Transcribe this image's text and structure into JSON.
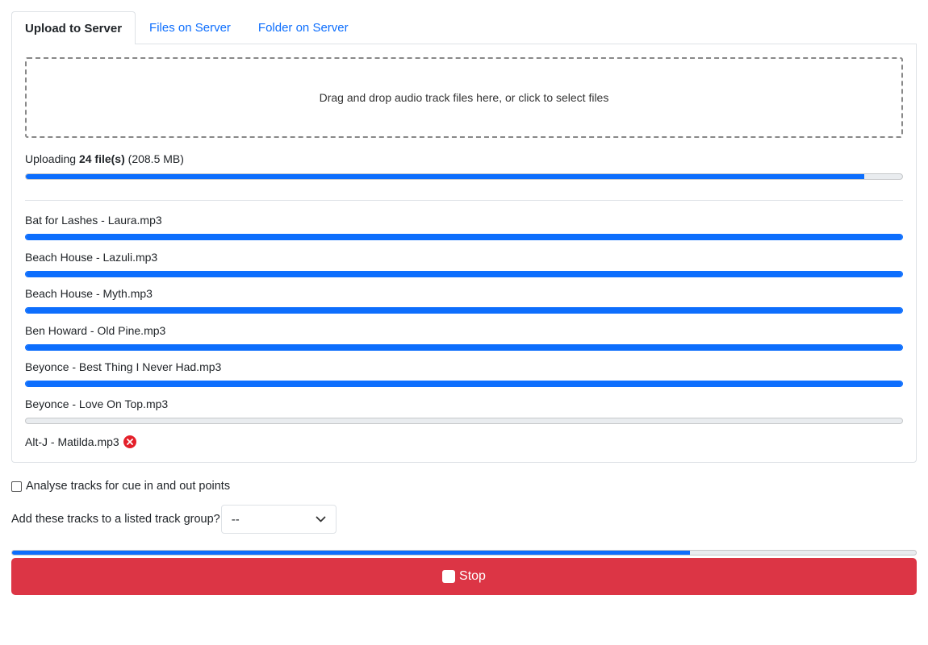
{
  "tabs": [
    {
      "label": "Upload to Server",
      "active": true
    },
    {
      "label": "Files on Server",
      "active": false
    },
    {
      "label": "Folder on Server",
      "active": false
    }
  ],
  "dropzone": {
    "text": "Drag and drop audio track files here, or click to select files"
  },
  "uploading": {
    "prefix": "Uploading",
    "count": "24 file(s)",
    "size": "(208.5 MB)",
    "progress": 0.957
  },
  "files": [
    {
      "name": "Bat for Lashes - Laura.mp3",
      "progress": 1.0
    },
    {
      "name": "Beach House - Lazuli.mp3",
      "progress": 1.0
    },
    {
      "name": "Beach House - Myth.mp3",
      "progress": 1.0
    },
    {
      "name": "Ben Howard - Old Pine.mp3",
      "progress": 1.0
    },
    {
      "name": "Beyonce - Best Thing I Never Had.mp3",
      "progress": 1.0
    },
    {
      "name": "Beyonce - Love On Top.mp3",
      "progress": 0.0
    }
  ],
  "error_file": {
    "name": "Alt-J - Matilda.mp3",
    "icon": "error-x-icon",
    "color": "#e4202a"
  },
  "options": {
    "analyse_label": "Analyse tracks for cue in and out points",
    "analyse_checked": false,
    "group_label": "Add these tracks to a listed track group?",
    "group_selected": "--"
  },
  "total_progress": 0.75,
  "stop_button": {
    "label": "Stop",
    "icon": "stop-square-icon",
    "color": "#dc3545"
  },
  "colors": {
    "accent": "#0d6efd",
    "danger": "#dc3545"
  }
}
